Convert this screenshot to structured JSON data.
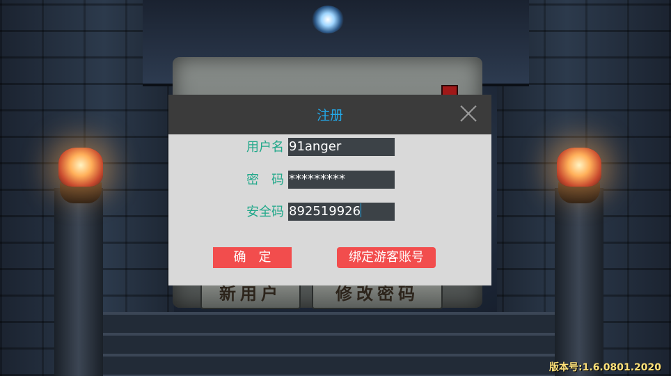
{
  "scene": {
    "stone_buttons": [
      "新用户",
      "修改密码"
    ]
  },
  "dialog": {
    "title": "注册",
    "fields": [
      {
        "label": "用户名",
        "value": "91anger"
      },
      {
        "label": "密　码",
        "value": "*********"
      },
      {
        "label": "安全码",
        "value": "892519926"
      }
    ],
    "confirm_label": "确　定",
    "bind_guest_label": "绑定游客账号"
  },
  "footer": {
    "version": "版本号:1.6.0801.2020"
  },
  "colors": {
    "title": "#23a7e6",
    "label": "#21a88a",
    "button": "#f24d4d",
    "version": "#ffe27a"
  }
}
